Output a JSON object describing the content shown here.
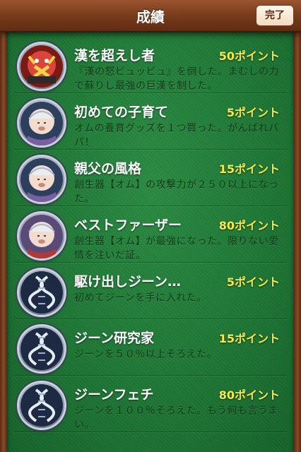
{
  "header": {
    "title": "成績",
    "done_label": "完了"
  },
  "colors": {
    "felt": "#1f7a35",
    "wood": "#7c3e1e",
    "points": "#f6e94a"
  },
  "achievements": [
    {
      "name": "漢を超えし者",
      "points": "50ポイント",
      "desc": "『漢の怒ビュッビュ』を倒した。まむしの力で蘇りし最強の巨漢を制した。",
      "icon": "boss-badge-icon"
    },
    {
      "name": "初めての子育て",
      "points": "5ポイント",
      "desc": "オムの養育グッズを１つ買った。がんばれパパ！",
      "icon": "baby-badge-icon"
    },
    {
      "name": "親父の風格",
      "points": "15ポイント",
      "desc": "創生器【オム】の攻撃力が２５０以上になった。",
      "icon": "baby-badge-icon"
    },
    {
      "name": "ベストファーザー",
      "points": "80ポイント",
      "desc": "創生器【オム】が最強になった。限りない愛情を注いだ証。",
      "icon": "baby-badge-icon"
    },
    {
      "name": "駆け出しジーン…",
      "points": "5ポイント",
      "desc": "初めてジーンを手に入れた。",
      "icon": "dna-badge-icon"
    },
    {
      "name": "ジーン研究家",
      "points": "15ポイント",
      "desc": "ジーンを５０％以上そろえた。",
      "icon": "dna-badge-icon"
    },
    {
      "name": "ジーンフェチ",
      "points": "80ポイント",
      "desc": "ジーンを１００％そろえた。もう何も言うまい。",
      "icon": "dna-badge-icon"
    }
  ]
}
